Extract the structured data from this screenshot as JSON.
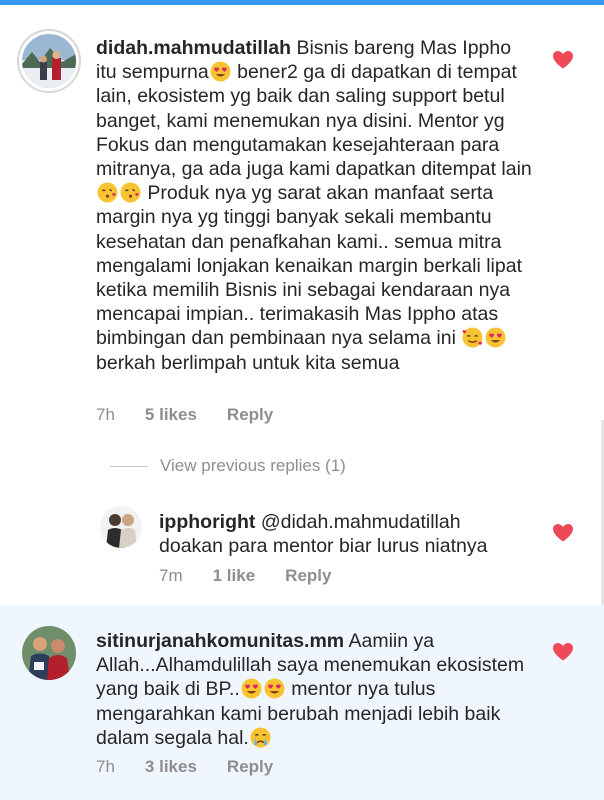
{
  "colors": {
    "accent": "#3897f0",
    "heart": "#ed4956",
    "meta": "#8e8e8e",
    "highlight": "#eff6fe"
  },
  "comments": [
    {
      "username": "didah.mahmudatillah",
      "text_parts": [
        " Bisnis bareng Mas Ippho itu sempurna",
        " bener2 ga di dapatkan di tempat lain, ekosistem yg baik dan saling support betul banget, kami menemukan nya disini. Mentor yg Fokus dan mengutamakan kesejahteraan para mitranya, ga ada juga kami dapatkan ditempat lain ",
        " Produk nya yg sarat akan manfaat serta margin nya yg tinggi banyak sekali membantu kesehatan dan penafkahan kami.. semua mitra mengalami lonjakan kenaikan margin berkali lipat ketika memilih Bisnis ini sebagai kendaraan nya mencapai impian.. terimakasih Mas Ippho atas bimbingan dan pembinaan nya selama ini ",
        " berkah berlimpah untuk kita semua"
      ],
      "time": "7h",
      "likes": "5 likes",
      "reply": "Reply"
    },
    {
      "username": "ipphoright",
      "mention": "@didah.mahmudatillah",
      "text": "doakan para mentor biar lurus niatnya",
      "time": "7m",
      "likes": "1 like",
      "reply": "Reply"
    },
    {
      "username": "sitinurjanahkomunitas.mm",
      "text_parts": [
        " Aamiin ya Allah...Alhamdulillah saya menemukan ekosistem yang baik di BP..",
        " mentor nya tulus mengarahkan kami berubah menjadi lebih baik dalam segala hal."
      ],
      "time": "7h",
      "likes": "3 likes",
      "reply": "Reply"
    }
  ],
  "view_previous": "View previous replies (1)"
}
